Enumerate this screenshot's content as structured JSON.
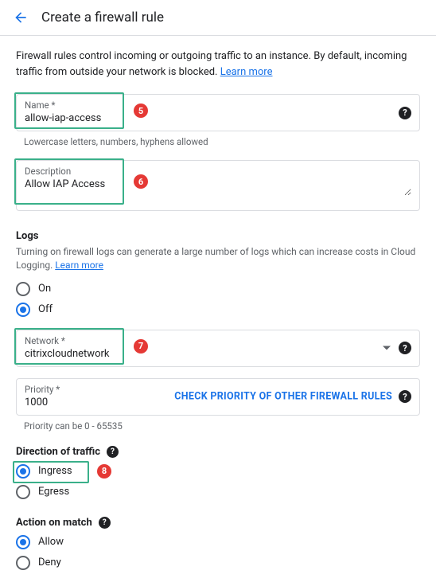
{
  "header": {
    "title": "Create a firewall rule"
  },
  "intro": {
    "text": "Firewall rules control incoming or outgoing traffic to an instance. By default, incoming traffic from outside your network is blocked. ",
    "learn_more": "Learn more"
  },
  "name": {
    "label": "Name *",
    "value": "allow-iap-access",
    "hint": "Lowercase letters, numbers, hyphens allowed",
    "callout": "5"
  },
  "description": {
    "label": "Description",
    "value": "Allow IAP Access",
    "callout": "6"
  },
  "logs": {
    "title": "Logs",
    "desc": "Turning on firewall logs can generate a large number of logs which can increase costs in Cloud Logging. ",
    "learn_more": "Learn more",
    "options": {
      "on": "On",
      "off": "Off"
    },
    "selected": "off"
  },
  "network": {
    "label": "Network *",
    "value": "citrixcloudnetwork",
    "callout": "7"
  },
  "priority": {
    "label": "Priority *",
    "value": "1000",
    "action": "CHECK PRIORITY OF OTHER FIREWALL RULES",
    "hint": "Priority can be 0 - 65535"
  },
  "direction": {
    "title": "Direction of traffic",
    "options": {
      "ingress": "Ingress",
      "egress": "Egress"
    },
    "selected": "ingress",
    "callout": "8"
  },
  "action": {
    "title": "Action on match",
    "options": {
      "allow": "Allow",
      "deny": "Deny"
    },
    "selected": "allow"
  }
}
